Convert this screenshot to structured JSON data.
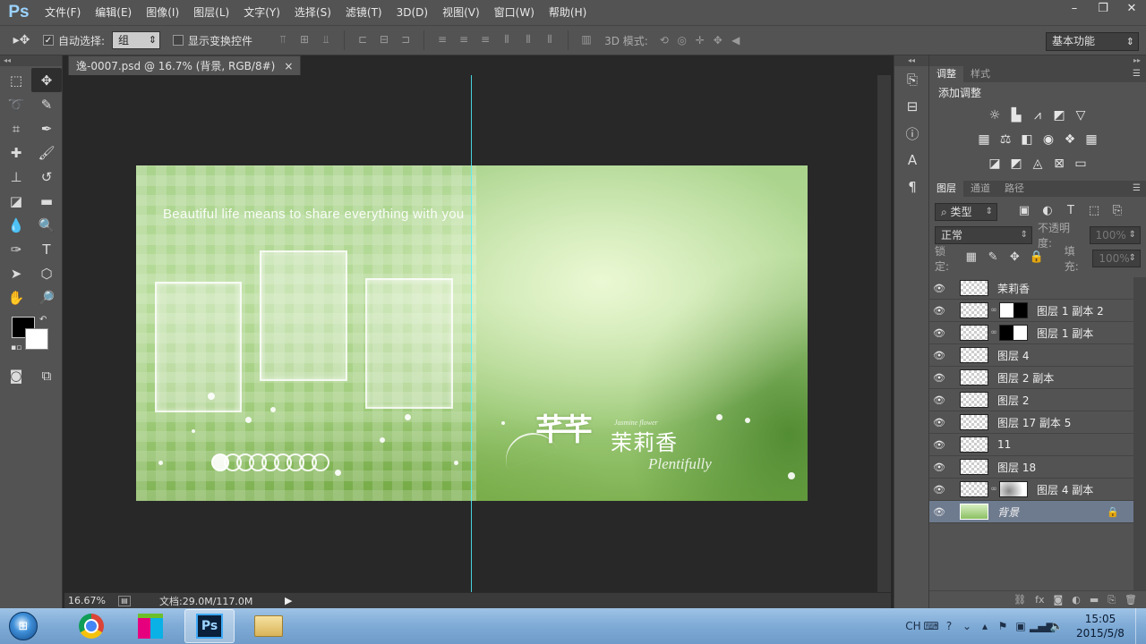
{
  "app": {
    "logo": "Ps",
    "menu": [
      "文件(F)",
      "编辑(E)",
      "图像(I)",
      "图层(L)",
      "文字(Y)",
      "选择(S)",
      "滤镜(T)",
      "3D(D)",
      "视图(V)",
      "窗口(W)",
      "帮助(H)"
    ],
    "window_controls": {
      "minimize": "–",
      "restore": "❐",
      "close": "✕"
    }
  },
  "options_bar": {
    "tool_icon": "move-tool",
    "auto_select_label": "自动选择:",
    "auto_select_checked": true,
    "auto_select_value": "组",
    "show_transform_label": "显示变换控件",
    "show_transform_checked": false,
    "mode_3d_label": "3D 模式:",
    "workspace": "基本功能"
  },
  "document": {
    "tab_title": "逸-0007.psd @ 16.7% (背景, RGB/8#)",
    "tab_close": "×",
    "zoom": "16.67%",
    "doc_size": "文档:29.0M/117.0M",
    "artwork": {
      "tagline": "Beautiful life means to share everything with you",
      "logo_mark": "芊芊",
      "logo_cn": "茉莉香",
      "logo_small_en": "Jasmine flower",
      "logo_en": "Plentifully"
    }
  },
  "panels": {
    "adjustments": {
      "tabs": [
        "调整",
        "样式"
      ],
      "active_tab": "调整",
      "title": "添加调整",
      "icons_row1": [
        "brightness-icon",
        "levels-icon",
        "curves-icon",
        "exposure-icon",
        "vibrance-icon"
      ],
      "icons_row2": [
        "hue-saturation-icon",
        "color-balance-icon",
        "black-white-icon",
        "photo-filter-icon",
        "channel-mixer-icon",
        "color-lookup-icon"
      ],
      "icons_row3": [
        "invert-icon",
        "posterize-icon",
        "threshold-icon",
        "selective-color-icon",
        "gradient-map-icon"
      ]
    },
    "layers": {
      "tabs": [
        "图层",
        "通道",
        "路径"
      ],
      "active_tab": "图层",
      "filter_kind": "类型",
      "blend_mode": "正常",
      "opacity_label": "不透明度:",
      "opacity_value": "100%",
      "lock_label": "锁定:",
      "fill_label": "填充:",
      "fill_value": "100%",
      "items": [
        {
          "name": "茉莉香",
          "mask": ""
        },
        {
          "name": "图层 1 副本 2",
          "mask": "white-black"
        },
        {
          "name": "图层 1 副本",
          "mask": "black-white"
        },
        {
          "name": "图层 4",
          "mask": ""
        },
        {
          "name": "图层 2 副本",
          "mask": ""
        },
        {
          "name": "图层 2",
          "mask": ""
        },
        {
          "name": "图层 17 副本 5",
          "mask": ""
        },
        {
          "name": "11",
          "mask": ""
        },
        {
          "name": "图层 18",
          "mask": ""
        },
        {
          "name": "图层 4 副本",
          "mask": "soft"
        },
        {
          "name": "背景",
          "mask": "",
          "locked": true,
          "selected": true
        }
      ]
    }
  },
  "taskbar": {
    "apps": [
      "chrome",
      "store",
      "photoshop",
      "explorer"
    ],
    "active_app": "photoshop",
    "lang": "CH",
    "time": "15:05",
    "date": "2015/5/8"
  }
}
